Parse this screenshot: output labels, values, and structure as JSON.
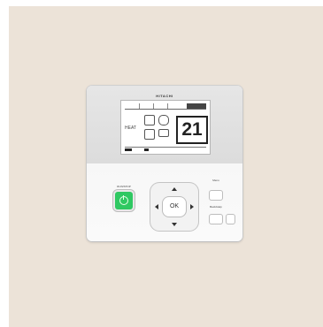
{
  "device": {
    "brand": "HITACHI",
    "screen": {
      "temperature": "21",
      "mode": "HEAT"
    },
    "power_label": "RUN/STOP",
    "ok_label": "OK",
    "buttons": {
      "menu": "Menu",
      "back": "Back/Help"
    }
  },
  "colors": {
    "background": "#ece3d8",
    "power_button": "#2fc862",
    "panel": "#f4f4f4"
  }
}
